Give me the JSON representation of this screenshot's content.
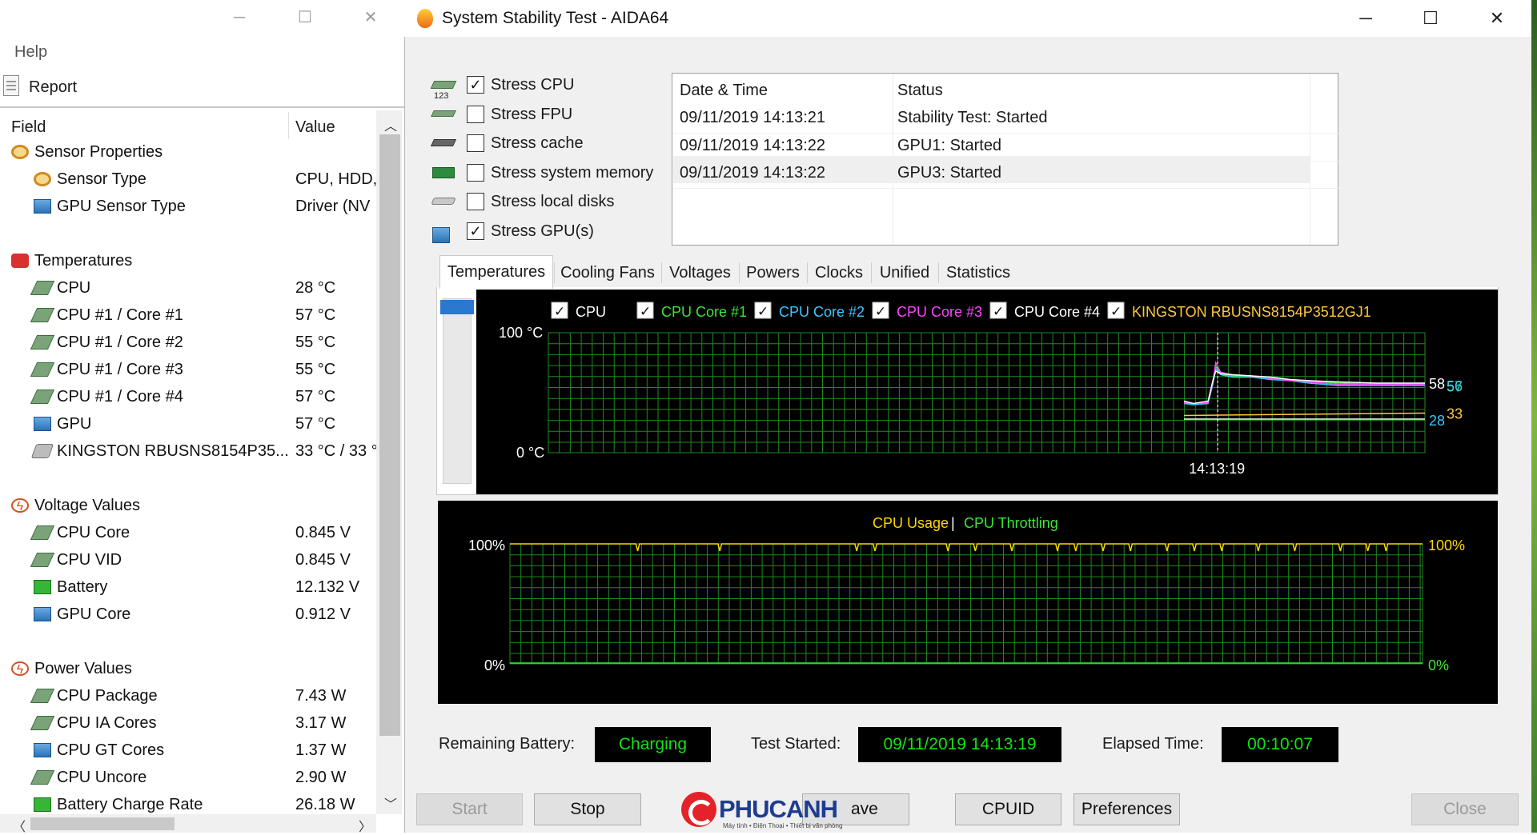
{
  "left_window": {
    "menu_help": "Help",
    "report_label": "Report",
    "columns": {
      "field": "Field",
      "value": "Value"
    },
    "rows": [
      {
        "label": "Sensor Properties",
        "value": "",
        "icon": "sensor-icon",
        "level": 0
      },
      {
        "label": "Sensor Type",
        "value": "CPU, HDD,",
        "icon": "sensor-icon",
        "level": 1
      },
      {
        "label": "GPU Sensor Type",
        "value": "Driver  (NV",
        "icon": "gpu-icon",
        "level": 1
      },
      {
        "label": "Temperatures",
        "value": "",
        "icon": "thermometer-icon",
        "level": 0
      },
      {
        "label": "CPU",
        "value": "28 °C",
        "icon": "chip-icon",
        "level": 1
      },
      {
        "label": "CPU #1 / Core #1",
        "value": "57 °C",
        "icon": "chip-icon",
        "level": 1
      },
      {
        "label": "CPU #1 / Core #2",
        "value": "55 °C",
        "icon": "chip-icon",
        "level": 1
      },
      {
        "label": "CPU #1 / Core #3",
        "value": "55 °C",
        "icon": "chip-icon",
        "level": 1
      },
      {
        "label": "CPU #1 / Core #4",
        "value": "57 °C",
        "icon": "chip-icon",
        "level": 1
      },
      {
        "label": "GPU",
        "value": "57 °C",
        "icon": "gpu-icon",
        "level": 1
      },
      {
        "label": "KINGSTON RBUSNS8154P35...",
        "value": "33 °C / 33 °",
        "icon": "disk-icon",
        "level": 1
      },
      {
        "label": "Voltage Values",
        "value": "",
        "icon": "bolt-icon",
        "level": 0
      },
      {
        "label": "CPU Core",
        "value": "0.845 V",
        "icon": "chip-icon",
        "level": 1
      },
      {
        "label": "CPU VID",
        "value": "0.845 V",
        "icon": "chip-icon",
        "level": 1
      },
      {
        "label": "Battery",
        "value": "12.132 V",
        "icon": "battery-icon",
        "level": 1
      },
      {
        "label": "GPU Core",
        "value": "0.912 V",
        "icon": "gpu-icon",
        "level": 1
      },
      {
        "label": "Power Values",
        "value": "",
        "icon": "bolt-icon",
        "level": 0
      },
      {
        "label": "CPU Package",
        "value": "7.43 W",
        "icon": "chip-icon",
        "level": 1
      },
      {
        "label": "CPU IA Cores",
        "value": "3.17 W",
        "icon": "chip-icon",
        "level": 1
      },
      {
        "label": "CPU GT Cores",
        "value": "1.37 W",
        "icon": "gpu-icon",
        "level": 1
      },
      {
        "label": "CPU Uncore",
        "value": "2.90 W",
        "icon": "chip-icon",
        "level": 1
      },
      {
        "label": "Battery Charge Rate",
        "value": "26.18 W",
        "icon": "battery-icon",
        "level": 1
      }
    ]
  },
  "main_window": {
    "title": "System Stability Test - AIDA64",
    "stress_options": [
      {
        "label": "Stress CPU",
        "checked": true,
        "icon": "cpu-chip-icon"
      },
      {
        "label": "Stress FPU",
        "checked": false,
        "icon": "fpu-icon"
      },
      {
        "label": "Stress cache",
        "checked": false,
        "icon": "cache-icon"
      },
      {
        "label": "Stress system memory",
        "checked": false,
        "icon": "memory-icon"
      },
      {
        "label": "Stress local disks",
        "checked": false,
        "icon": "disk-icon"
      },
      {
        "label": "Stress GPU(s)",
        "checked": true,
        "icon": "gpu-icon"
      }
    ],
    "fpu_icon_text": "123",
    "log": {
      "headers": {
        "date": "Date & Time",
        "status": "Status"
      },
      "rows": [
        {
          "date": "09/11/2019 14:13:21",
          "status": "Stability Test: Started"
        },
        {
          "date": "09/11/2019 14:13:22",
          "status": "GPU1: Started"
        },
        {
          "date": "09/11/2019 14:13:22",
          "status": "GPU3: Started"
        }
      ]
    },
    "tabs": [
      "Temperatures",
      "Cooling Fans",
      "Voltages",
      "Powers",
      "Clocks",
      "Unified",
      "Statistics"
    ],
    "active_tab": "Temperatures",
    "status": {
      "battery_label": "Remaining Battery:",
      "battery_value": "Charging",
      "started_label": "Test Started:",
      "started_value": "09/11/2019 14:13:19",
      "elapsed_label": "Elapsed Time:",
      "elapsed_value": "00:10:07"
    },
    "buttons": {
      "start": "Start",
      "stop": "Stop",
      "save_partial": "ave",
      "cpuid": "CPUID",
      "preferences": "Preferences",
      "close": "Close"
    },
    "watermark": {
      "brand": "PHUCANH",
      "tagline": "Máy tính • Điện Thoại • Thiết bị văn phòng"
    }
  },
  "chart_data": [
    {
      "type": "line",
      "legend": [
        {
          "name": "CPU",
          "color": "#ffffff"
        },
        {
          "name": "CPU Core #1",
          "color": "#39e639"
        },
        {
          "name": "CPU Core #2",
          "color": "#3cc7ff"
        },
        {
          "name": "CPU Core #3",
          "color": "#ff44ff"
        },
        {
          "name": "CPU Core #4",
          "color": "#ffffff"
        },
        {
          "name": "KINGSTON RBUSNS8154P3512GJ1",
          "color": "#ffc83d"
        }
      ],
      "y_top_label": "100 °C",
      "y_bottom_label": "0 °C",
      "ylim": [
        0,
        100
      ],
      "x_marker_label": "14:13:19",
      "right_labels": [
        {
          "text": "58",
          "value": 58,
          "color": "#ffffff"
        },
        {
          "text": "57",
          "value": 57,
          "color": "#39e639"
        },
        {
          "text": "56",
          "value": 56,
          "color": "#3cc7ff"
        },
        {
          "text": "28",
          "value": 28,
          "color": "#3cc7ff"
        },
        {
          "text": "33",
          "value": 33,
          "color": "#ffc83d"
        }
      ],
      "series": [
        {
          "name": "CPU Core #1",
          "color": "#39e639",
          "x": [
            0,
            10,
            25,
            30,
            33,
            38,
            50,
            70,
            90,
            110,
            130,
            160,
            200,
            250
          ],
          "values": [
            42,
            40,
            42,
            58,
            72,
            66,
            64,
            64,
            62,
            61,
            60,
            58,
            57,
            57
          ]
        },
        {
          "name": "CPU Core #2",
          "color": "#3cc7ff",
          "x": [
            0,
            10,
            25,
            30,
            33,
            38,
            50,
            70,
            90,
            110,
            130,
            160,
            200,
            250
          ],
          "values": [
            41,
            40,
            41,
            57,
            70,
            65,
            63,
            63,
            61,
            60,
            58,
            56,
            56,
            56
          ]
        },
        {
          "name": "CPU Core #3",
          "color": "#ff44ff",
          "x": [
            0,
            10,
            25,
            30,
            33,
            38,
            50,
            70,
            90,
            110,
            130,
            160,
            200,
            250
          ],
          "values": [
            42,
            41,
            42,
            59,
            75,
            67,
            65,
            64,
            62,
            60,
            59,
            57,
            57,
            57
          ]
        },
        {
          "name": "CPU Core #4",
          "color": "#ffffff",
          "x": [
            0,
            10,
            25,
            30,
            33,
            38,
            50,
            70,
            90,
            110,
            130,
            160,
            200,
            250
          ],
          "values": [
            43,
            41,
            43,
            60,
            68,
            66,
            65,
            64,
            63,
            61,
            60,
            59,
            58,
            58
          ]
        },
        {
          "name": "KINGSTON RBUSNS8154P3512GJ1",
          "color": "#ffc83d",
          "x": [
            0,
            250
          ],
          "values": [
            31,
            33
          ]
        },
        {
          "name": "CPU",
          "color": "#ffffff",
          "x": [
            0,
            250
          ],
          "values": [
            28,
            28
          ]
        }
      ]
    },
    {
      "type": "line",
      "title_left": "CPU Usage",
      "title_sep": "|",
      "title_right": "CPU Throttling",
      "title_left_color": "#ffd700",
      "title_right_color": "#39e639",
      "y_left_top": "100%",
      "y_left_bottom": "0%",
      "y_right_top": "100%",
      "y_right_bottom": "0%",
      "ylim": [
        0,
        100
      ],
      "series": [
        {
          "name": "CPU Usage",
          "color": "#ffd700",
          "x": [
            0,
            100
          ],
          "values": [
            100,
            100
          ],
          "dips": [
            14,
            23,
            38,
            40,
            48,
            51,
            55,
            60,
            62,
            65,
            68,
            72,
            75,
            78,
            82,
            86,
            91,
            94,
            96
          ]
        },
        {
          "name": "CPU Throttling",
          "color": "#39e639",
          "x": [
            0,
            100
          ],
          "values": [
            0,
            0
          ]
        }
      ]
    }
  ],
  "colors": {
    "grid": "#1f8a1f",
    "status_text": "#15e015",
    "slider": "#2a78d0"
  }
}
